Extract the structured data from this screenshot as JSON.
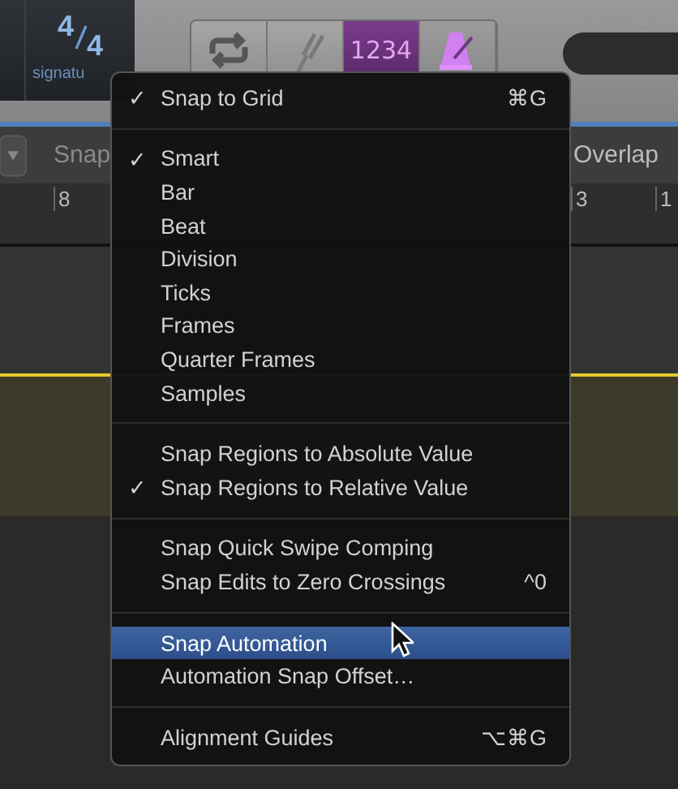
{
  "toolbar": {
    "time_signature": {
      "numerator": "4",
      "denominator": "4",
      "label": "signatu"
    },
    "buttons": [
      {
        "kind": "cycle",
        "selected": false
      },
      {
        "kind": "tuner",
        "selected": false
      },
      {
        "kind": "count_in",
        "text": "1234",
        "selected": true
      },
      {
        "kind": "metronome",
        "selected": true
      }
    ]
  },
  "snap_bar": {
    "snap_label": "Snap",
    "drag_label": "Overlap"
  },
  "ruler": {
    "numbers": [
      {
        "text": "8"
      },
      {
        "text": "3"
      },
      {
        "text": "1"
      }
    ]
  },
  "menu": {
    "sections": [
      [
        {
          "label": "Snap to Grid",
          "checked": true,
          "selected": false,
          "shortcut": "⌘G"
        }
      ],
      [
        {
          "label": "Smart",
          "checked": true,
          "selected": false
        },
        {
          "label": "Bar",
          "checked": false,
          "selected": false
        },
        {
          "label": "Beat",
          "checked": false,
          "selected": false
        },
        {
          "label": "Division",
          "checked": false,
          "selected": false
        },
        {
          "label": "Ticks",
          "checked": false,
          "selected": false
        },
        {
          "label": "Frames",
          "checked": false,
          "selected": false
        },
        {
          "label": "Quarter Frames",
          "checked": false,
          "selected": false
        },
        {
          "label": "Samples",
          "checked": false,
          "selected": false
        }
      ],
      [
        {
          "label": "Snap Regions to Absolute Value",
          "checked": false,
          "selected": false
        },
        {
          "label": "Snap Regions to Relative Value",
          "checked": true,
          "selected": false
        }
      ],
      [
        {
          "label": "Snap Quick Swipe Comping",
          "checked": false,
          "selected": false
        },
        {
          "label": "Snap Edits to Zero Crossings",
          "checked": false,
          "selected": false,
          "shortcut": "^0"
        }
      ],
      [
        {
          "label": "Snap Automation",
          "checked": false,
          "selected": true
        },
        {
          "label": "Automation Snap Offset…",
          "checked": false,
          "selected": false
        }
      ],
      [
        {
          "label": "Alignment Guides",
          "checked": false,
          "selected": false,
          "shortcut": "⌥⌘G"
        }
      ]
    ],
    "check_glyph": "✓"
  }
}
